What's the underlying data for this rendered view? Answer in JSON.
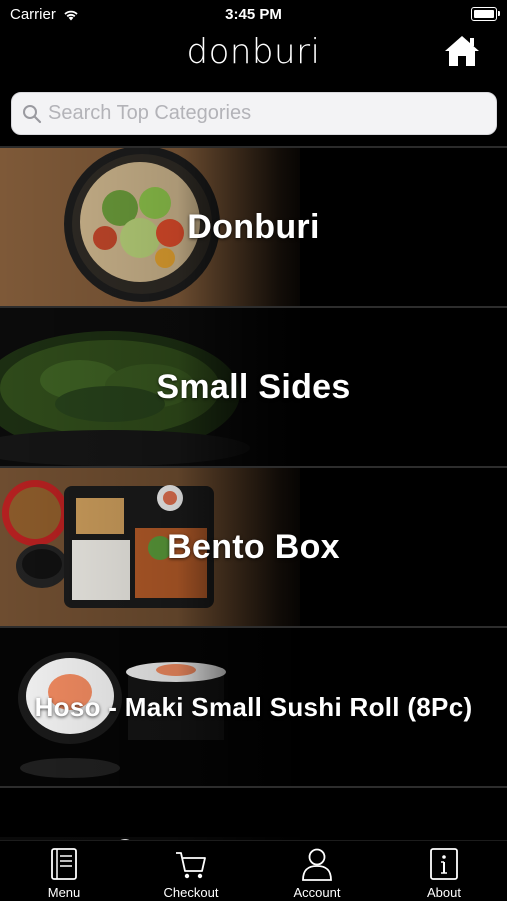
{
  "status_bar": {
    "carrier": "Carrier",
    "time": "3:45 PM"
  },
  "header": {
    "logo": "donburi"
  },
  "search": {
    "placeholder": "Search Top Categories",
    "value": ""
  },
  "categories": [
    {
      "label": "Donburi"
    },
    {
      "label": "Small Sides"
    },
    {
      "label": "Bento Box"
    },
    {
      "label": "Hoso - Maki Small Sushi Roll (8Pc)"
    }
  ],
  "tabbar": {
    "items": [
      {
        "label": "Menu",
        "icon": "menu-book-icon"
      },
      {
        "label": "Checkout",
        "icon": "cart-icon"
      },
      {
        "label": "Account",
        "icon": "person-icon"
      },
      {
        "label": "About",
        "icon": "info-icon"
      }
    ]
  }
}
